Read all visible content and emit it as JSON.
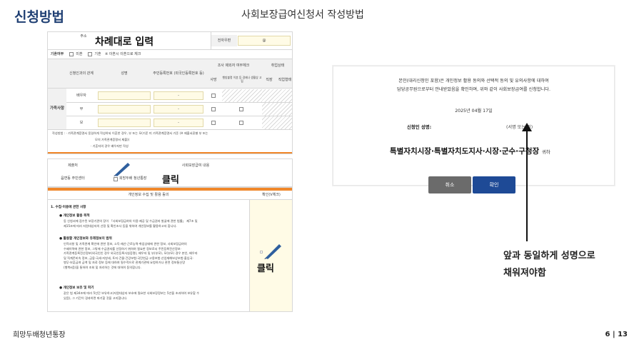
{
  "header": {
    "title": "신청방법",
    "subtitle": "사회보장급여신청서 작성방법"
  },
  "form_image": {
    "address_label": "주소",
    "address_overlay": "차례대로 입력",
    "phone_label": "전자우편",
    "email_at": "@",
    "marital_label": "기혼여부",
    "marital_options": [
      "미혼",
      "기혼"
    ],
    "marital_note": "※ 이혼시 이혼으로 체크",
    "table_headers": {
      "relation": "신청인과의 관계",
      "name": "성명",
      "rrn": "주민등록번호 (외국인등록번호 등)",
      "survey": "조사 제외자 여부체크",
      "survey_death": "사망",
      "survey_missing": "행방불명 이혼 등 경제나 생활상 고립",
      "employment": "취업상태",
      "employment_a": "직장",
      "employment_b": "직업형태"
    },
    "section_label": "가족사항",
    "rows": [
      {
        "relation": "배우자",
        "rrn": "-"
      },
      {
        "relation": "부",
        "rrn": "-"
      },
      {
        "relation": "모",
        "rrn": "-"
      }
    ],
    "note_1": "작성방법 : · 가족관계증명서 동일하게 작성하되 이혼한 경우, 부 또는 모(기준 미 가족관계증명서 기준 (※ 제출서류별 부 또는",
    "note_2": "모의 가족관계증명서 제출))",
    "note_3": "· 기혼자의 경우 배우자만 작성",
    "submitter_label": "제출처",
    "submitter_value": "읍면동 주민센터",
    "benefit_label": "사회보장급여 내용",
    "benefit_value": "희망두배 청년통장",
    "click_1": "클릭",
    "consent_title": "개인정보 수집 및 활용 동의",
    "consent_confirm": "확인(V체크)",
    "consent_section": "1. 수집·이용에 관한 사항",
    "consent_p1_head": "● 개인정보 활용 목적",
    "consent_p1_body": "동 신청서에 접수된 보장기관의 장이 「사회보장급여의 이용·제공 및 수급권자 발굴에 관한 법률」 제7조 및\n제15조에 따라 지원대상자의 선정 및 확인조사 등을 위하여 개인정보를 활용하고자 합니다.",
    "consent_p2_head": "● 활용할 개인정보와 유래정보의 범위",
    "consent_p2_body": "인적사항 및 가족관계 확인에 관한 정보, 소득·재산·근로능력·취업상태에 관한 정보, 사회보장급여의\n수혜이력에 관한 정보, 그밖에 수급권자를 선정하기 위하여 필요한 정보로서 주민등록전산정보·\n가족관계등록전산정보(외국인인 경우 외국인등록사실증명), 배우자 및 부(부모), 모(부모) 경우 본인, 배우자\n및 직계존비속 정보, 금융·국세·지방세, 토지·건물·건강보험·국민연금·고용보험·산업재해보상보험·출입국·\n병무·보훈급여 금액 및 자료 정보 등에 대하여 필수적으로 관계기관에 요청하거나 관련 정보통신망\n(행복e음)을 통하여 조회 및 처리하는 것에 대하여 동의합니다.",
    "consent_p3_head": "● 개인정보 보유 및 파기",
    "consent_p3_body": "같은 법 제34조에 따라 5년간 보유하고(지원대상자 보호에 필요한 사회보장정보는 5년을 초과하여 보유할 수\n있음), 그 기간이 경과하면 파기할 것을 고지합니다.",
    "click_2": "클릭"
  },
  "dialog": {
    "body_line1": "본인(대리신청인 포함)은 개인정보 활용 동의와 선택적 동의 및 유의사항에 대하여",
    "body_line2": "담당공무원으로부터 안내받았음을 확인하며, 위와 같이 사회보장급여를 신청합니다.",
    "date": "2025년 04월 17일",
    "signer_label": "신청인 성명:",
    "signer_hint": "(서명 또는 인)",
    "recipient": "특별자치시장·특별자치도지사·시장·군수·구청장",
    "recipient_suffix": "귀하",
    "cancel_label": "취소",
    "confirm_label": "확인"
  },
  "note": {
    "line1": "앞과 동일하게 성명으로",
    "line2": "채워져야함"
  },
  "footer": {
    "left": "희망두배청년통장",
    "page": "6 | 13"
  },
  "colors": {
    "title": "#1f3f73",
    "confirm_button": "#1e4a96",
    "cancel_button": "#6b6b6b",
    "accent_orange": "#f0872a",
    "input_yellow": "#fffbe6"
  }
}
